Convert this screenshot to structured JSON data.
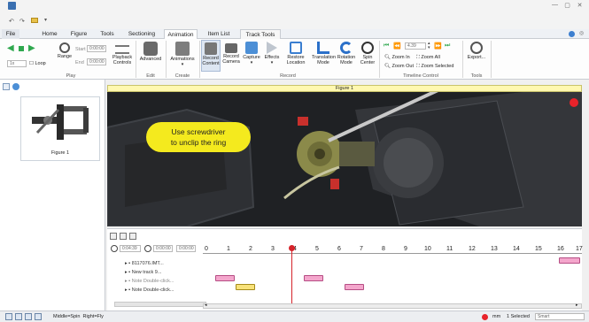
{
  "qat": {
    "app_icon": "app-logo-icon"
  },
  "tabs": [
    {
      "label": "File"
    },
    {
      "label": "Home"
    },
    {
      "label": "Figure"
    },
    {
      "label": "Tools"
    },
    {
      "label": "Sectioning"
    },
    {
      "label": "Animation",
      "active": true
    },
    {
      "label": "Item List"
    },
    {
      "label": "Track Tools"
    }
  ],
  "ribbon": {
    "play": {
      "loop_label": "Loop",
      "speed_value": "1x",
      "range_label": "Range",
      "start_label": "Start",
      "start_value": "0:00:00",
      "end_label": "End",
      "end_value": "0:00:00",
      "playback_controls_label": "Playback Controls",
      "group_label": "Play"
    },
    "edit": {
      "advanced_label": "Advanced",
      "group_label": "Edit"
    },
    "create": {
      "animations_label": "Animations",
      "group_label": "Create"
    },
    "record": {
      "record_content_label": "Record Content",
      "record_camera_label": "Record Camera",
      "capture_label": "Capture",
      "effects_label": "Effects",
      "restore_location_label": "Restore Location",
      "translation_mode_label": "Translation Mode",
      "rotation_mode_label": "Rotation Mode",
      "spin_center_label": "Spin Center",
      "group_label": "Record"
    },
    "timeline_control": {
      "time_value": "4.39",
      "zoom_in_label": "Zoom In",
      "zoom_all_label": "Zoom All",
      "zoom_out_label": "Zoom Out",
      "zoom_selected_label": "Zoom Selected",
      "group_label": "Timeline Control"
    },
    "tools": {
      "export_label": "Export...",
      "group_label": "Tools"
    }
  },
  "gallery": {
    "thumb_label": "Figure 1"
  },
  "viewport": {
    "title": "Figure 1",
    "callout_line1": "Use screwdriver",
    "callout_line2": "to unclip the ring",
    "colors": {
      "callout": "#f4ea1e",
      "indicator": "#e8232a",
      "clip": "#c8302c"
    }
  },
  "timeline": {
    "current_time": "0:04:39",
    "start_time": "0:00:00",
    "end_time": "0:00:00",
    "tracks": [
      {
        "label": "8117076.IMT..."
      },
      {
        "label": "New track 9..."
      },
      {
        "label": "Note Double-click..."
      },
      {
        "label": "Note Double-click..."
      }
    ],
    "ruler_ticks": [
      "0",
      "1",
      "2",
      "3",
      "4",
      "5",
      "6",
      "7",
      "8",
      "9",
      "10",
      "11",
      "12",
      "13",
      "14",
      "15",
      "16",
      "17"
    ],
    "scroll_left": "◂",
    "scroll_right": "▸"
  },
  "status": {
    "left_text": "Middle=Spin  Right=Fly",
    "unit_label": "mm",
    "selected_text": "1 Selected",
    "mode_value": "Smart"
  }
}
